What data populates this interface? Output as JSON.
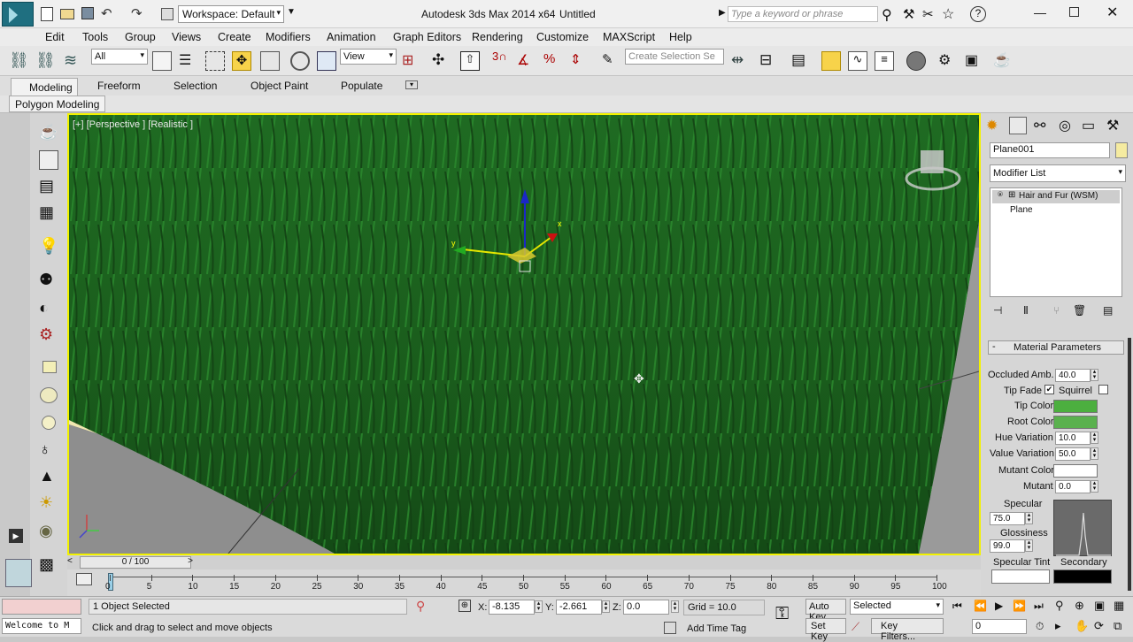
{
  "titlebar": {
    "workspace": "Workspace: Default",
    "app_title": "Autodesk 3ds Max  2014 x64",
    "doc_title": "Untitled",
    "search_placeholder": "Type a keyword or phrase"
  },
  "menu": [
    "Edit",
    "Tools",
    "Group",
    "Views",
    "Create",
    "Modifiers",
    "Animation",
    "Graph Editors",
    "Rendering",
    "Customize",
    "MAXScript",
    "Help"
  ],
  "toolbar": {
    "filter": "All",
    "ref_coord": "View",
    "selection_set_placeholder": "Create Selection Se",
    "snaps_value": "3"
  },
  "ribbon": {
    "tabs": [
      "Modeling",
      "Freeform",
      "Selection",
      "Object Paint",
      "Populate"
    ],
    "subpanel": "Polygon Modeling"
  },
  "viewport": {
    "label": "[+] [Perspective ] [Realistic ]",
    "axis_x": "x",
    "axis_y": "y"
  },
  "timeslider": {
    "value": "0 / 100"
  },
  "ruler": {
    "ticks": [
      "0",
      "5",
      "10",
      "15",
      "20",
      "25",
      "30",
      "35",
      "40",
      "45",
      "50",
      "55",
      "60",
      "65",
      "70",
      "75",
      "80",
      "85",
      "90",
      "95",
      "100"
    ]
  },
  "cmdpanel": {
    "object_name": "Plane001",
    "modifier_list": "Modifier List",
    "stack": [
      "Hair and Fur (WSM)",
      "Plane"
    ],
    "rollout_title": "Material Parameters",
    "params": {
      "occluded_amb_label": "Occluded Amb.",
      "occluded_amb": "40.0",
      "tip_fade_label": "Tip Fade",
      "squirrel_label": "Squirrel",
      "tip_color_label": "Tip Color",
      "root_color_label": "Root Color",
      "hue_variation_label": "Hue Variation",
      "hue_variation": "10.0",
      "value_variation_label": "Value Variation",
      "value_variation": "50.0",
      "mutant_color_label": "Mutant Color",
      "mutant_label": "Mutant",
      "mutant": "0.0",
      "specular_label": "Specular",
      "specular": "75.0",
      "glossiness_label": "Glossiness",
      "glossiness": "99.0",
      "specular_tint_label": "Specular Tint",
      "secondary_label": "Secondary"
    },
    "colors": {
      "tip_color": "#4caf3f",
      "root_color": "#5ab14e",
      "mutant_color": "#ffffff",
      "specular_tint": "#ffffff",
      "secondary": "#000000"
    }
  },
  "statusbar": {
    "maxscript_listener": "Welcome to M",
    "selection_status": "1 Object Selected",
    "prompt": "Click and drag to select and move objects",
    "x_label": "X:",
    "x": "-8.135",
    "y_label": "Y:",
    "y": "-2.661",
    "z_label": "Z:",
    "z": "0.0",
    "grid": "Grid = 10.0",
    "add_time_tag": "Add Time Tag",
    "auto_key": "Auto Key",
    "set_key": "Set Key",
    "key_mode": "Selected",
    "key_filters": "Key Filters...",
    "frame": "0"
  }
}
